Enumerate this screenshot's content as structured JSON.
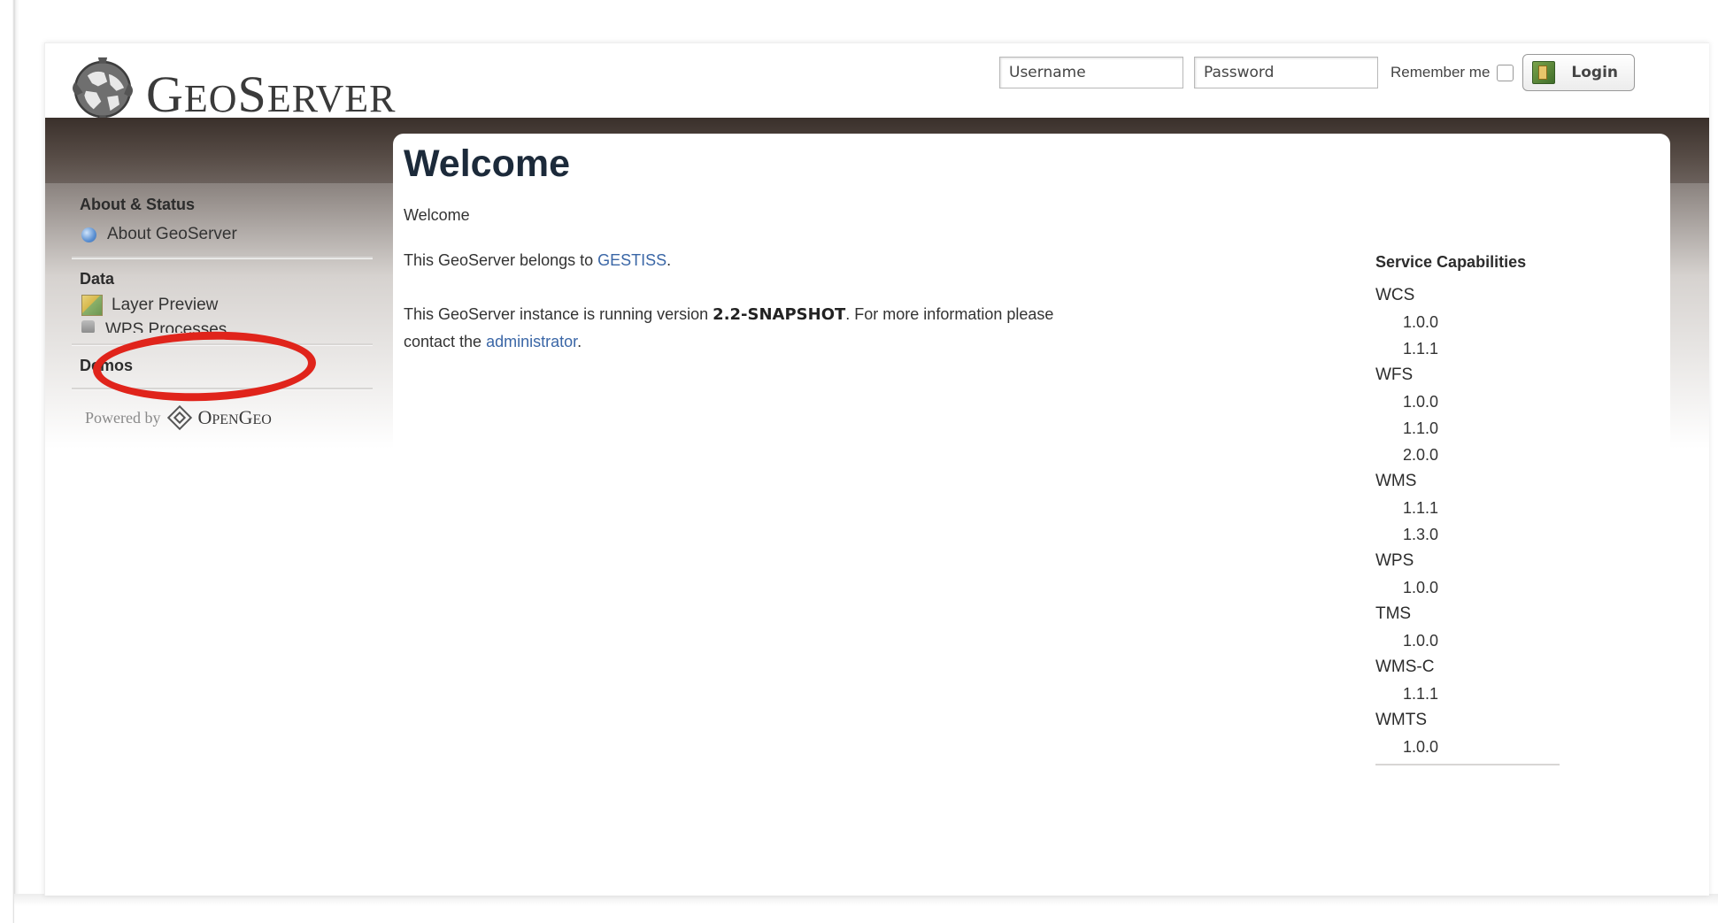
{
  "header": {
    "logo_text_first": "G",
    "logo_text_eo": "EO",
    "logo_text_s": "S",
    "logo_text_erver": "ERVER",
    "username_placeholder": "Username",
    "password_placeholder": "Password",
    "remember_label": "Remember me",
    "login_label": "Login"
  },
  "sidebar": {
    "sections": [
      {
        "heading": "About & Status",
        "items": [
          {
            "label": "About GeoServer",
            "icon": "globe-icon"
          }
        ]
      },
      {
        "heading": "Data",
        "items": [
          {
            "label": "Layer Preview",
            "icon": "layer-preview-icon"
          },
          {
            "label": "WPS Processes",
            "icon": "process-icon"
          }
        ]
      },
      {
        "heading": "Demos",
        "items": []
      }
    ],
    "powered_by": "Powered by",
    "opengeo_big1": "O",
    "opengeo_small1": "PEN",
    "opengeo_big2": "G",
    "opengeo_small2": "EO"
  },
  "main": {
    "title": "Welcome",
    "welcome_text": "Welcome",
    "belongs_prefix": "This GeoServer belongs to ",
    "belongs_link": "GESTISS",
    "belongs_suffix": ".",
    "version_prefix": "This GeoServer instance is running version ",
    "version": "2.2-SNAPSHOT",
    "version_suffix": ". For more information please",
    "contact_prefix": "contact the ",
    "contact_link": "administrator",
    "contact_suffix": "."
  },
  "capabilities": {
    "title": "Service Capabilities",
    "services": [
      {
        "name": "WCS",
        "versions": [
          "1.0.0",
          "1.1.1"
        ]
      },
      {
        "name": "WFS",
        "versions": [
          "1.0.0",
          "1.1.0",
          "2.0.0"
        ]
      },
      {
        "name": "WMS",
        "versions": [
          "1.1.1",
          "1.3.0"
        ]
      },
      {
        "name": "WPS",
        "versions": [
          "1.0.0"
        ]
      },
      {
        "name": "TMS",
        "versions": [
          "1.0.0"
        ]
      },
      {
        "name": "WMS-C",
        "versions": [
          "1.1.1"
        ]
      },
      {
        "name": "WMTS",
        "versions": [
          "1.0.0"
        ]
      }
    ]
  },
  "annotation": {
    "color": "#e0241b"
  }
}
